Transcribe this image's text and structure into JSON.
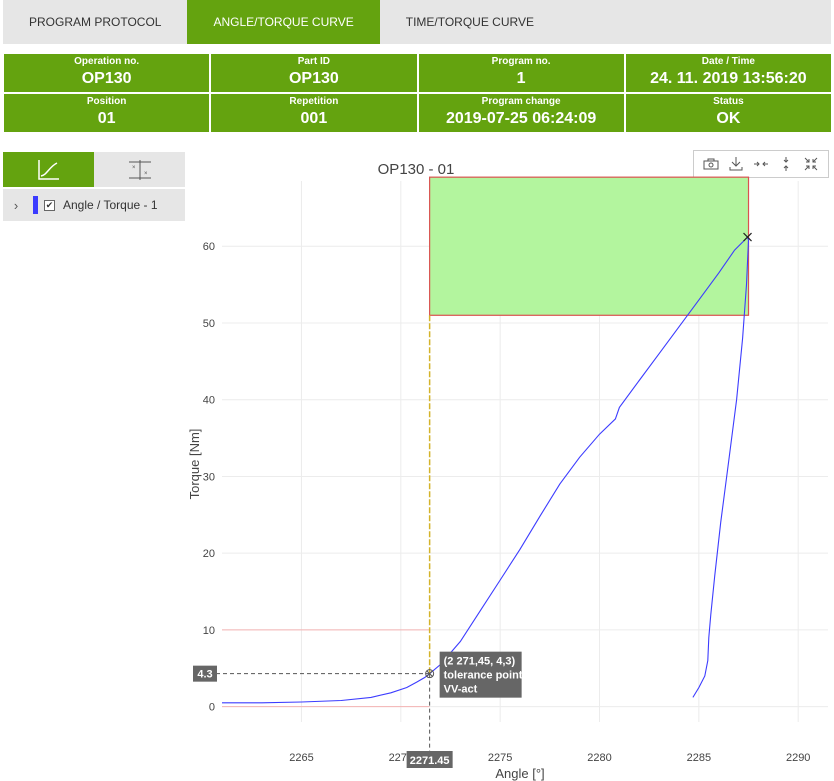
{
  "tabs": [
    {
      "label": "PROGRAM PROTOCOL",
      "active": false
    },
    {
      "label": "ANGLE/TORQUE CURVE",
      "active": true
    },
    {
      "label": "TIME/TORQUE CURVE",
      "active": false
    }
  ],
  "info": {
    "operation_no": {
      "label": "Operation no.",
      "value": "OP130"
    },
    "part_id": {
      "label": "Part ID",
      "value": "OP130"
    },
    "program_no": {
      "label": "Program no.",
      "value": "1"
    },
    "date_time": {
      "label": "Date / Time",
      "value": "24. 11. 2019 13:56:20"
    },
    "position": {
      "label": "Position",
      "value": "01"
    },
    "repetition": {
      "label": "Repetition",
      "value": "001"
    },
    "program_change": {
      "label": "Program change",
      "value": "2019-07-25 06:24:09"
    },
    "status": {
      "label": "Status",
      "value": "OK"
    }
  },
  "legend": {
    "label": "Angle / Torque - 1",
    "checked": true,
    "color": "#3c3cff"
  },
  "colors": {
    "accent": "#64a30f",
    "curve": "#3c3cff",
    "window_fill": "#b3f59e",
    "window_border": "#d9534f",
    "limit_line": "#f4b3b3",
    "marker_line": "#d4b32a"
  },
  "toolbar_icons": [
    "camera-icon",
    "download-icon",
    "zoom-in-horizontal-icon",
    "zoom-in-vertical-icon",
    "reset-zoom-icon"
  ],
  "chart_data": {
    "type": "line",
    "title": "OP130 - 01",
    "xlabel": "Angle [°]",
    "ylabel": "Torque [Nm]",
    "xlim": [
      2261,
      2291.5
    ],
    "ylim": [
      -2,
      68.5
    ],
    "xticks": [
      "2265",
      "2270",
      "2275",
      "2280",
      "2285",
      "2290"
    ],
    "yticks": [
      "0",
      "10",
      "20",
      "30",
      "40",
      "50",
      "60"
    ],
    "xtick_values": [
      2265,
      2270,
      2275,
      2280,
      2285,
      2290
    ],
    "ytick_values": [
      0,
      10,
      20,
      30,
      40,
      50,
      60
    ],
    "grid": true,
    "series": [
      {
        "name": "Angle / Torque - 1",
        "x": [
          2261,
          2263,
          2265,
          2267,
          2268.5,
          2269.5,
          2270.3,
          2270.8,
          2271.2,
          2271.45,
          2272,
          2273,
          2274,
          2275,
          2276,
          2277,
          2278,
          2279,
          2280,
          2280.8,
          2281,
          2282,
          2283,
          2284,
          2285,
          2286,
          2286.8,
          2287.3,
          2287.45,
          2287.5,
          2287.4,
          2287.2,
          2286.9,
          2286.5,
          2286.1,
          2285.8,
          2285.6,
          2285.5,
          2285.45,
          2285.3,
          2285.0,
          2284.7
        ],
        "y": [
          0.5,
          0.5,
          0.6,
          0.8,
          1.2,
          1.8,
          2.5,
          3.2,
          3.8,
          4.3,
          5.5,
          8.5,
          12.5,
          16.5,
          20.5,
          24.8,
          29.0,
          32.5,
          35.5,
          37.5,
          39.0,
          42.5,
          46.0,
          49.5,
          53.0,
          56.5,
          59.5,
          60.8,
          61.2,
          60.8,
          55.0,
          48.0,
          40.0,
          32.0,
          24.0,
          17.0,
          12.0,
          9.0,
          6.0,
          4.0,
          2.5,
          1.2
        ]
      }
    ],
    "window": {
      "x_min": 2271.45,
      "x_max": 2287.5,
      "y_min": 51,
      "y_max": 69
    },
    "threshold_lines": [
      {
        "y": 0,
        "x_max": 2271.45
      },
      {
        "y": 10,
        "x_max": 2271.45
      }
    ],
    "end_marker": {
      "x": 2287.45,
      "y": 61.2
    },
    "tolerance_point": {
      "x": 2271.45,
      "y": 4.3,
      "label_lines": [
        "(2 271,45, 4,3)",
        "tolerance point",
        "VV-act"
      ],
      "x_label": "2271.45",
      "y_label": "4.3"
    }
  }
}
